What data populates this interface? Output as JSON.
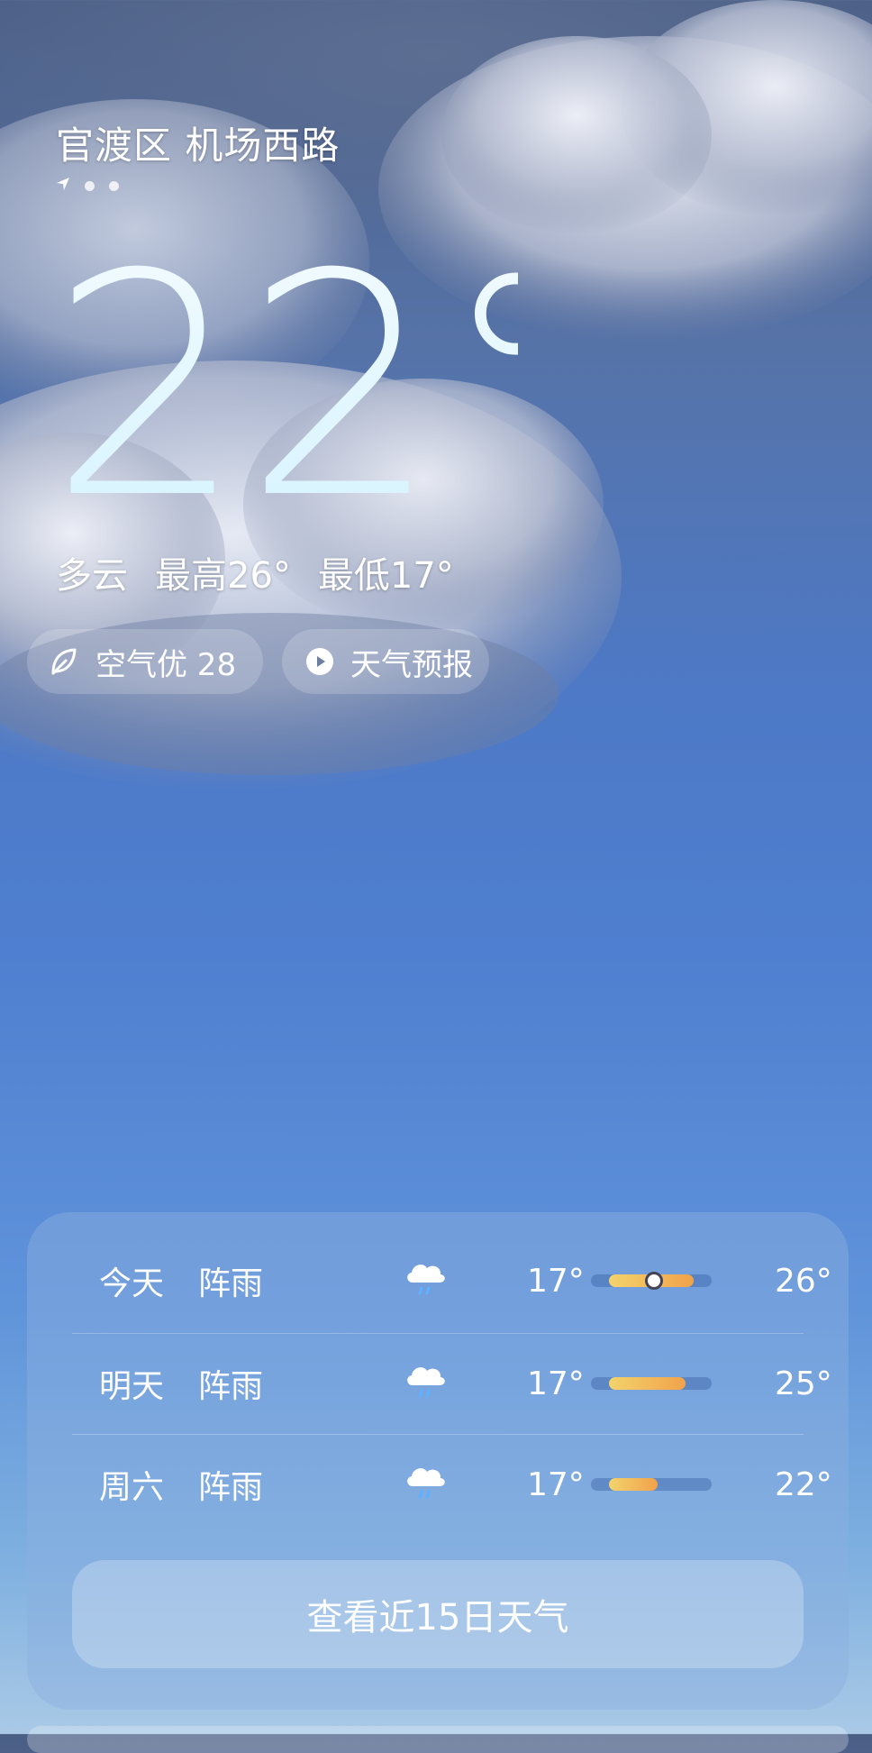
{
  "header": {
    "location": "官渡区 机场西路",
    "page_dots": [
      "location-arrow",
      "dot",
      "dot"
    ]
  },
  "current": {
    "temperature": "22°",
    "condition": "多云",
    "high": "最高26°",
    "low": "最低17°"
  },
  "chips": {
    "air_quality": "空气优 28",
    "forecast_video": "天气预报"
  },
  "forecast": {
    "days": [
      {
        "day": "今天",
        "condition": "阵雨",
        "icon": "shower-icon",
        "low": "17°",
        "high": "26°",
        "bar_fill": [
          0.15,
          0.85
        ],
        "current_marker": 0.52
      },
      {
        "day": "明天",
        "condition": "阵雨",
        "icon": "shower-icon",
        "low": "17°",
        "high": "25°",
        "bar_fill": [
          0.15,
          0.78
        ],
        "current_marker": null
      },
      {
        "day": "周六",
        "condition": "阵雨",
        "icon": "shower-icon",
        "low": "17°",
        "high": "22°",
        "bar_fill": [
          0.15,
          0.55
        ],
        "current_marker": null
      }
    ],
    "button_label": "查看近15日天气"
  },
  "colors": {
    "sky_top": "#4b5f86",
    "sky_bottom": "#a9c9e6",
    "temp_bar_start": "#f3d36c",
    "temp_bar_end": "#f1a24a"
  }
}
